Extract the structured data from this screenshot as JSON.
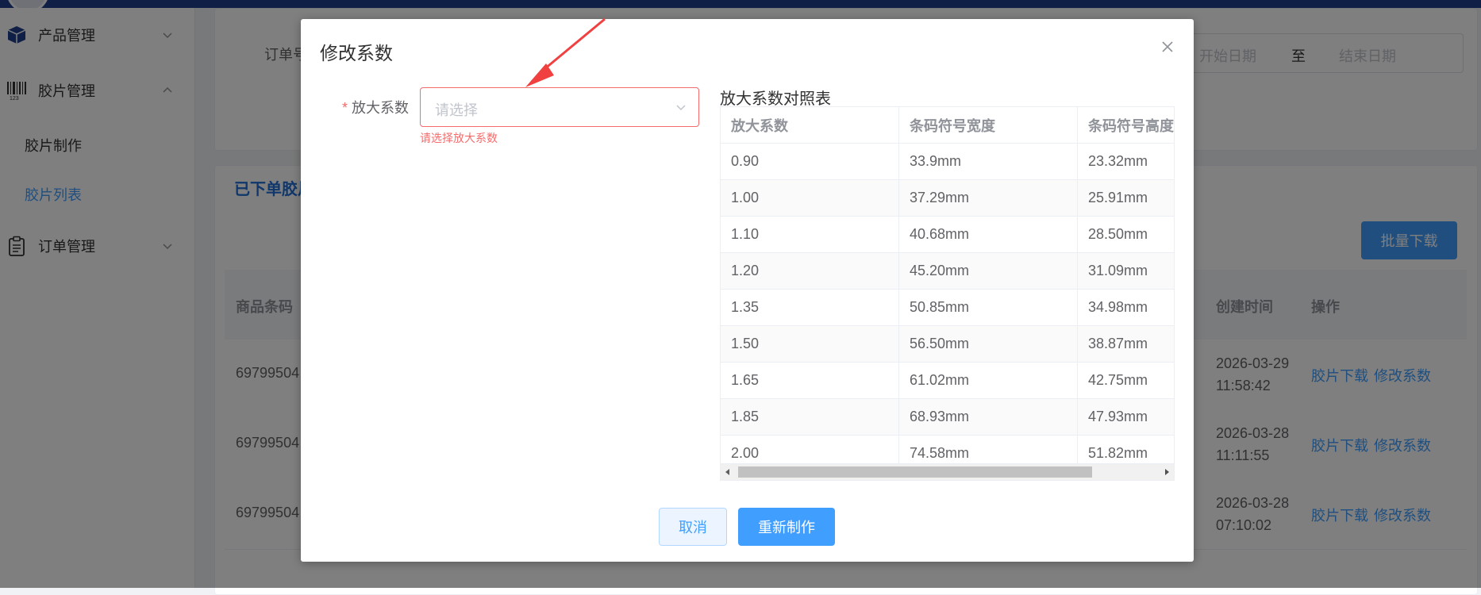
{
  "sidebar": {
    "menus": [
      {
        "label": "产品管理",
        "icon": "box-icon"
      },
      {
        "label": "胶片管理",
        "icon": "barcode-icon"
      },
      {
        "label": "订单管理",
        "icon": "clipboard-icon"
      }
    ],
    "film_submenu": [
      {
        "label": "胶片制作",
        "active": false
      },
      {
        "label": "胶片列表",
        "active": true
      }
    ]
  },
  "filter": {
    "order_label": "订单号",
    "start_placeholder": "开始日期",
    "range_separator": "至",
    "end_placeholder": "结束日期"
  },
  "list": {
    "title": "已下单胶片",
    "batch_download": "批量下载",
    "columns": {
      "barcode": "商品条码",
      "created": "创建时间",
      "actions": "操作"
    },
    "rows": [
      {
        "barcode": "69799504",
        "date": "2026-03-29",
        "time": "11:58:42"
      },
      {
        "barcode": "69799504",
        "date": "2026-03-28",
        "time": "11:11:55"
      },
      {
        "barcode": "69799504",
        "date": "2026-03-28",
        "time": "07:10:02"
      }
    ],
    "action_download": "胶片下载",
    "action_modify": "修改系数"
  },
  "dialog": {
    "title": "修改系数",
    "field_label": "放大系数",
    "required_mark": "*",
    "select_placeholder": "请选择",
    "error_text": "请选择放大系数",
    "ref_title": "放大系数对照表",
    "ref_columns": [
      "放大系数",
      "条码符号宽度",
      "条码符号高度"
    ],
    "ref_rows": [
      [
        "0.90",
        "33.9mm",
        "23.32mm"
      ],
      [
        "1.00",
        "37.29mm",
        "25.91mm"
      ],
      [
        "1.10",
        "40.68mm",
        "28.50mm"
      ],
      [
        "1.20",
        "45.20mm",
        "31.09mm"
      ],
      [
        "1.35",
        "50.85mm",
        "34.98mm"
      ],
      [
        "1.50",
        "56.50mm",
        "38.87mm"
      ],
      [
        "1.65",
        "61.02mm",
        "42.75mm"
      ],
      [
        "1.85",
        "68.93mm",
        "47.93mm"
      ],
      [
        "2.00",
        "74.58mm",
        "51.82mm"
      ]
    ],
    "cancel": "取消",
    "confirm": "重新制作"
  },
  "colors": {
    "primary": "#409eff",
    "danger": "#f56c6c",
    "topbar": "#1f3f8a",
    "annotation_arrow": "#f04040"
  }
}
